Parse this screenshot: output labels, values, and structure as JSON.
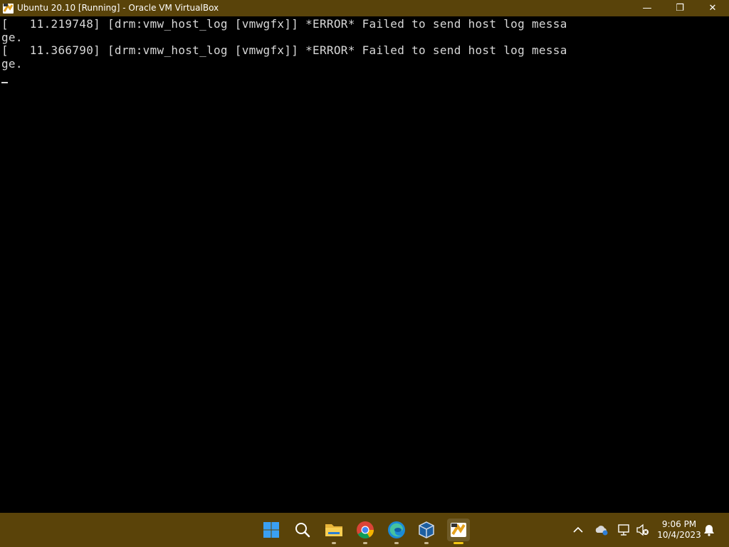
{
  "window": {
    "title": "Ubuntu 20.10 [Running] - Oracle VM VirtualBox",
    "controls": {
      "minimize": "—",
      "maximize": "❐",
      "close": "✕"
    },
    "title_bar_color": "#59430a"
  },
  "console": {
    "lines": [
      "[   11.219748] [drm:vmw_host_log [vmwgfx]] *ERROR* Failed to send host log messa",
      "ge.",
      "[   11.366790] [drm:vmw_host_log [vmwgfx]] *ERROR* Failed to send host log messa",
      "ge."
    ]
  },
  "taskbar": {
    "color": "#5a4309",
    "apps": [
      {
        "name": "start",
        "icon": "windows-start-icon"
      },
      {
        "name": "search",
        "icon": "search-icon"
      },
      {
        "name": "file-explorer",
        "icon": "folder-icon"
      },
      {
        "name": "chrome",
        "icon": "chrome-icon"
      },
      {
        "name": "edge",
        "icon": "edge-icon"
      },
      {
        "name": "virtualbox-manager",
        "icon": "virtualbox-icon"
      },
      {
        "name": "virtualbox-vm",
        "icon": "virtualbox-vm-icon"
      }
    ],
    "tray": {
      "icons": [
        "chevron-up-icon",
        "onedrive-icon",
        "network-icon",
        "volume-muted-icon",
        "bell-icon"
      ],
      "time": "9:06 PM",
      "date": "10/4/2023"
    }
  }
}
